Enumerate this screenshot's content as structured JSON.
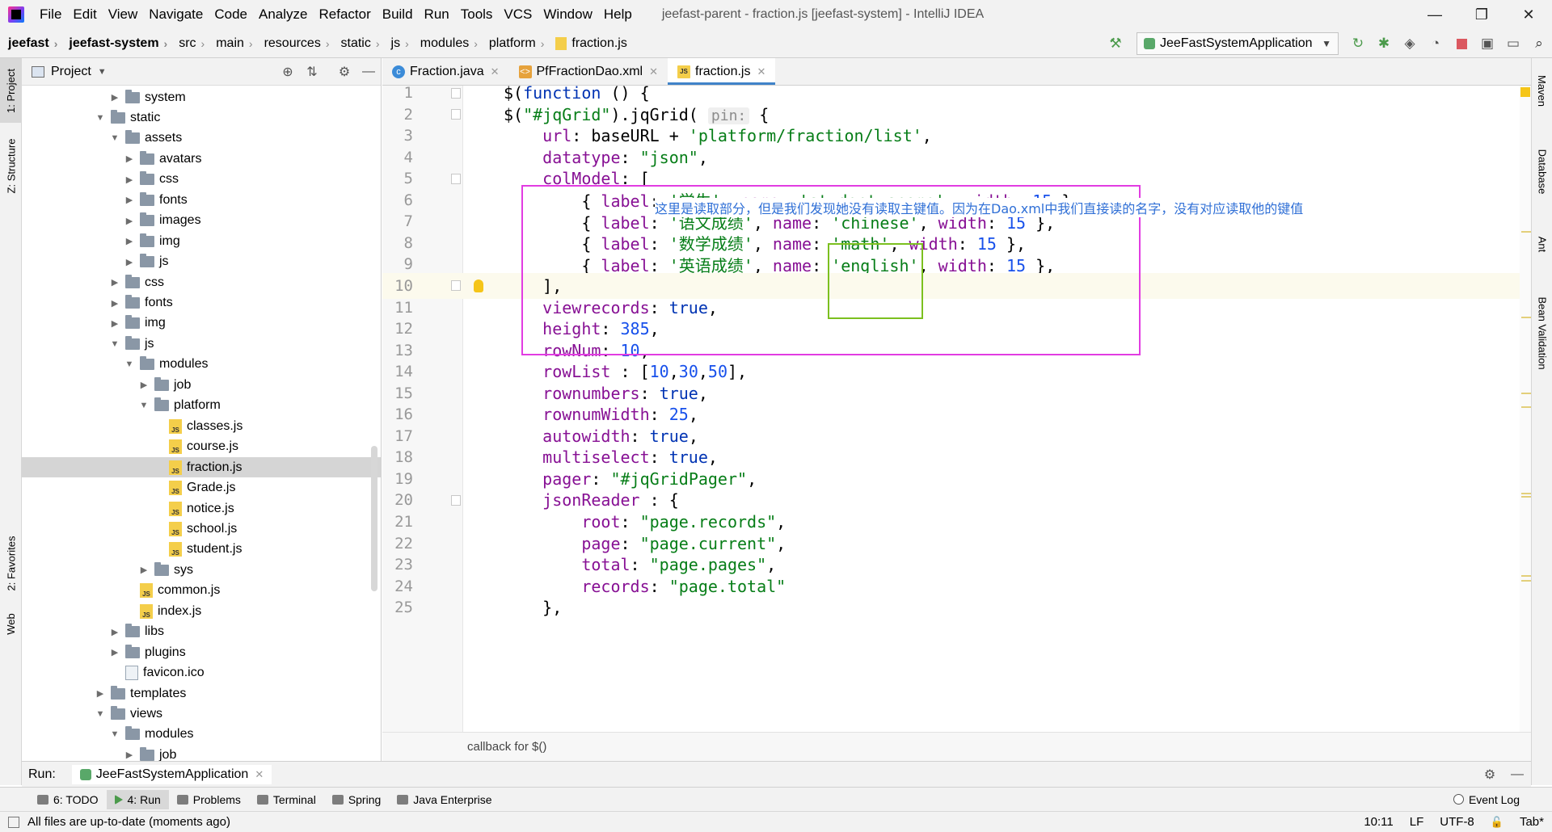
{
  "menubar": {
    "items": [
      "File",
      "Edit",
      "View",
      "Navigate",
      "Code",
      "Analyze",
      "Refactor",
      "Build",
      "Run",
      "Tools",
      "VCS",
      "Window",
      "Help"
    ],
    "title": "jeefast-parent - fraction.js [jeefast-system] - IntelliJ IDEA",
    "minimize": "—",
    "restore": "❐",
    "close": "✕"
  },
  "breadcrumb": [
    "jeefast",
    "jeefast-system",
    "src",
    "main",
    "resources",
    "static",
    "js",
    "modules",
    "platform",
    "fraction.js"
  ],
  "run_config": "JeeFastSystemApplication",
  "left_strip": {
    "project": "1: Project",
    "structure": "Z: Structure",
    "favorites": "2: Favorites",
    "web": "Web"
  },
  "right_strip": {
    "maven": "Maven",
    "database": "Database",
    "ant": "Ant",
    "bean_validation": "Bean Validation"
  },
  "project_panel": {
    "title": "Project",
    "tree": [
      {
        "label": "system",
        "depth": 1,
        "type": "folder",
        "expanded": false
      },
      {
        "label": "static",
        "depth": 0,
        "type": "folder",
        "expanded": true
      },
      {
        "label": "assets",
        "depth": 1,
        "type": "folder",
        "expanded": true
      },
      {
        "label": "avatars",
        "depth": 2,
        "type": "folder",
        "expanded": false
      },
      {
        "label": "css",
        "depth": 2,
        "type": "folder",
        "expanded": false
      },
      {
        "label": "fonts",
        "depth": 2,
        "type": "folder",
        "expanded": false
      },
      {
        "label": "images",
        "depth": 2,
        "type": "folder",
        "expanded": false
      },
      {
        "label": "img",
        "depth": 2,
        "type": "folder",
        "expanded": false
      },
      {
        "label": "js",
        "depth": 2,
        "type": "folder",
        "expanded": false
      },
      {
        "label": "css",
        "depth": 1,
        "type": "folder",
        "expanded": false
      },
      {
        "label": "fonts",
        "depth": 1,
        "type": "folder",
        "expanded": false
      },
      {
        "label": "img",
        "depth": 1,
        "type": "folder",
        "expanded": false
      },
      {
        "label": "js",
        "depth": 1,
        "type": "folder",
        "expanded": true
      },
      {
        "label": "modules",
        "depth": 2,
        "type": "folder",
        "expanded": true
      },
      {
        "label": "job",
        "depth": 3,
        "type": "folder",
        "expanded": false
      },
      {
        "label": "platform",
        "depth": 3,
        "type": "folder",
        "expanded": true
      },
      {
        "label": "classes.js",
        "depth": 4,
        "type": "js"
      },
      {
        "label": "course.js",
        "depth": 4,
        "type": "js"
      },
      {
        "label": "fraction.js",
        "depth": 4,
        "type": "js",
        "selected": true
      },
      {
        "label": "Grade.js",
        "depth": 4,
        "type": "js"
      },
      {
        "label": "notice.js",
        "depth": 4,
        "type": "js"
      },
      {
        "label": "school.js",
        "depth": 4,
        "type": "js"
      },
      {
        "label": "student.js",
        "depth": 4,
        "type": "js"
      },
      {
        "label": "sys",
        "depth": 3,
        "type": "folder",
        "expanded": false
      },
      {
        "label": "common.js",
        "depth": 2,
        "type": "js"
      },
      {
        "label": "index.js",
        "depth": 2,
        "type": "js"
      },
      {
        "label": "libs",
        "depth": 1,
        "type": "folder",
        "expanded": false
      },
      {
        "label": "plugins",
        "depth": 1,
        "type": "folder",
        "expanded": false
      },
      {
        "label": "favicon.ico",
        "depth": 1,
        "type": "ico"
      },
      {
        "label": "templates",
        "depth": 0,
        "type": "folder",
        "expanded": false
      },
      {
        "label": "views",
        "depth": 0,
        "type": "folder",
        "expanded": true
      },
      {
        "label": "modules",
        "depth": 1,
        "type": "folder",
        "expanded": true
      },
      {
        "label": "job",
        "depth": 2,
        "type": "folder",
        "expanded": false
      }
    ]
  },
  "editor_tabs": [
    {
      "label": "Fraction.java",
      "icon": "class",
      "active": false
    },
    {
      "label": "PfFractionDao.xml",
      "icon": "xml",
      "active": false
    },
    {
      "label": "fraction.js",
      "icon": "js",
      "active": true
    }
  ],
  "code_lines": [
    {
      "n": "1",
      "html": "$(<span class=\"kw\">function</span> () {"
    },
    {
      "n": "2",
      "html": "$(<span class=\"str\">\"#jqGrid\"</span>).jqGrid( <span class=\"hint\">pin:</span> {"
    },
    {
      "n": "3",
      "html": "    <span class=\"prop\">url</span>: baseURL + <span class=\"str\">'platform/fraction/list'</span>,"
    },
    {
      "n": "4",
      "html": "    <span class=\"prop\">datatype</span>: <span class=\"str\">\"json\"</span>,"
    },
    {
      "n": "5",
      "html": "    <span class=\"prop\">colModel</span>: ["
    },
    {
      "n": "6",
      "html": "        { <span class=\"prop\">label</span>: <span class=\"str\">'学生'</span>, <span class=\"prop\">name</span>: <span class=\"str\">'student.sname'</span>, <span class=\"prop\">width</span>: <span class=\"num\">15</span> },"
    },
    {
      "n": "7",
      "html": "        { <span class=\"prop\">label</span>: <span class=\"str\">'语文成绩'</span>, <span class=\"prop\">name</span>: <span class=\"str\">'chinese'</span>, <span class=\"prop\">width</span>: <span class=\"num\">15</span> },"
    },
    {
      "n": "8",
      "html": "        { <span class=\"prop\">label</span>: <span class=\"str\">'数学成绩'</span>, <span class=\"prop\">name</span>: <span class=\"str\">'math'</span>, <span class=\"prop\">width</span>: <span class=\"num\">15</span> },"
    },
    {
      "n": "9",
      "html": "        { <span class=\"prop\">label</span>: <span class=\"str\">'英语成绩'</span>, <span class=\"prop\">name</span>: <span class=\"str\">'english'</span>, <span class=\"prop\">width</span>: <span class=\"num\">15</span> },"
    },
    {
      "n": "10",
      "html": "    ],"
    },
    {
      "n": "11",
      "html": "    <span class=\"prop\">viewrecords</span>: <span class=\"kw\">true</span>,"
    },
    {
      "n": "12",
      "html": "    <span class=\"prop\">height</span>: <span class=\"num\">385</span>,"
    },
    {
      "n": "13",
      "html": "    <span class=\"prop\">rowNum</span>: <span class=\"num\">10</span>,"
    },
    {
      "n": "14",
      "html": "    <span class=\"prop\">rowList</span> : [<span class=\"num\">10</span>,<span class=\"num\">30</span>,<span class=\"num\">50</span>],"
    },
    {
      "n": "15",
      "html": "    <span class=\"prop\">rownumbers</span>: <span class=\"kw\">true</span>,"
    },
    {
      "n": "16",
      "html": "    <span class=\"prop\">rownumWidth</span>: <span class=\"num\">25</span>,"
    },
    {
      "n": "17",
      "html": "    <span class=\"prop\">autowidth</span>: <span class=\"kw\">true</span>,"
    },
    {
      "n": "18",
      "html": "    <span class=\"prop\">multiselect</span>: <span class=\"kw\">true</span>,"
    },
    {
      "n": "19",
      "html": "    <span class=\"prop\">pager</span>: <span class=\"str\">\"#jqGridPager\"</span>,"
    },
    {
      "n": "20",
      "html": "    <span class=\"prop\">jsonReader</span> : {"
    },
    {
      "n": "21",
      "html": "        <span class=\"prop\">root</span>: <span class=\"str\">\"page.records\"</span>,"
    },
    {
      "n": "22",
      "html": "        <span class=\"prop\">page</span>: <span class=\"str\">\"page.current\"</span>,"
    },
    {
      "n": "23",
      "html": "        <span class=\"prop\">total</span>: <span class=\"str\">\"page.pages\"</span>,"
    },
    {
      "n": "24",
      "html": "        <span class=\"prop\">records</span>: <span class=\"str\">\"page.total\"</span>"
    },
    {
      "n": "25",
      "html": "    },"
    }
  ],
  "current_line": "10",
  "fold_lines": [
    "1",
    "2",
    "5",
    "10",
    "20"
  ],
  "annotation": "这里是读取部分，但是我们发现她没有读取主键值。因为在Dao.xml中我们直接读的名字，没有对应读取他的键值",
  "callback_hint": "callback for $()",
  "run_bar": {
    "label": "Run:",
    "tab": "JeeFastSystemApplication"
  },
  "tool_windows": [
    {
      "label": "6: TODO",
      "active": false
    },
    {
      "label": "4: Run",
      "active": true
    },
    {
      "label": "Problems",
      "active": false
    },
    {
      "label": "Terminal",
      "active": false
    },
    {
      "label": "Spring",
      "active": false
    },
    {
      "label": "Java Enterprise",
      "active": false
    }
  ],
  "event_log": "Event Log",
  "status": {
    "message": "All files are up-to-date (moments ago)",
    "position": "10:11",
    "line_sep": "LF",
    "encoding": "UTF-8",
    "indent": "Tab*"
  },
  "colors": {
    "magenta_box": "#e23ce2",
    "green_box": "#7cc01f",
    "annotation_text": "#2f6fd6",
    "tab_underline": "#4083c9"
  }
}
